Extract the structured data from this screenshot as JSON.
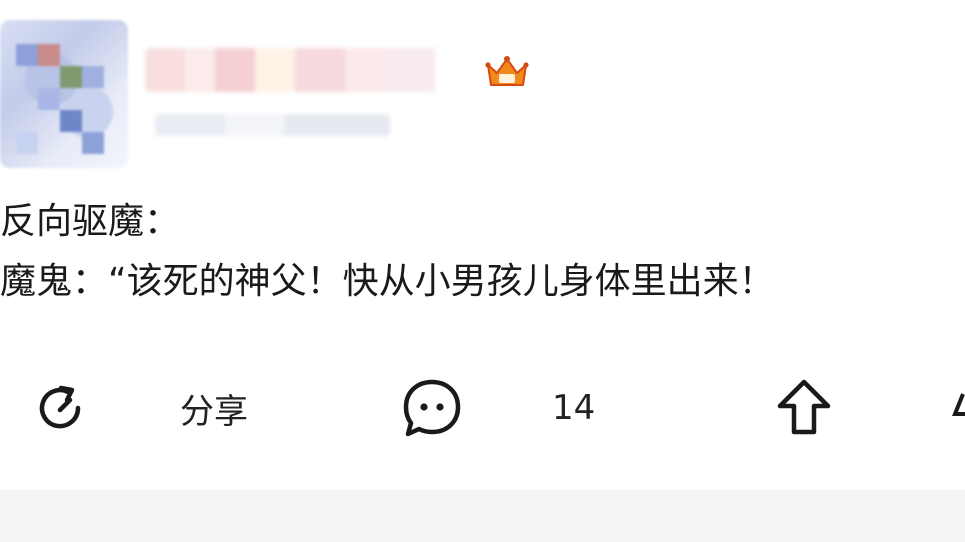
{
  "post": {
    "lines": [
      "反向驱魔：",
      "魔鬼：“该死的神父！快从小男孩儿身体里出来！"
    ]
  },
  "actions": {
    "share_label": "分享",
    "comment_count": "14"
  },
  "icons": {
    "share": "share-icon",
    "comment": "comment-icon",
    "upvote": "upvote-icon",
    "badge": "crown-badge-icon"
  },
  "colors": {
    "badge": "#f08a1c",
    "badge_dark": "#d9480f",
    "text": "#1a1a1a",
    "band": "#f4f4f6"
  }
}
